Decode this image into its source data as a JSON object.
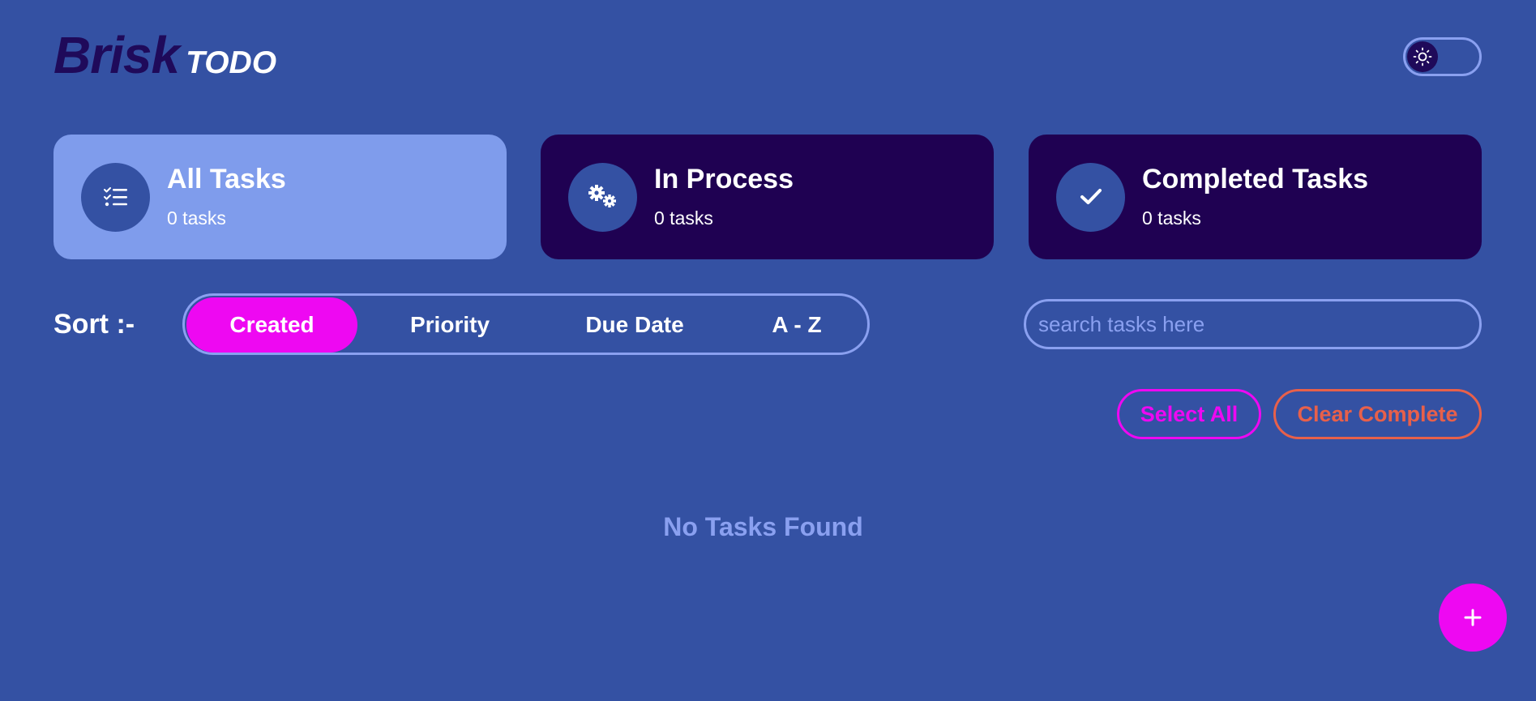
{
  "app": {
    "logo_brand": "Brisk",
    "logo_suffix": "TODO"
  },
  "theme_toggle": {
    "icon": "sun-icon",
    "state": "dark"
  },
  "cards": [
    {
      "title": "All Tasks",
      "count": "0 tasks",
      "icon": "list-check-icon",
      "active": true
    },
    {
      "title": "In Process",
      "count": "0 tasks",
      "icon": "gears-icon",
      "active": false
    },
    {
      "title": "Completed Tasks",
      "count": "0 tasks",
      "icon": "check-icon",
      "active": false
    }
  ],
  "sort": {
    "label": "Sort :-",
    "options": [
      "Created",
      "Priority",
      "Due Date",
      "A - Z"
    ],
    "selected": "Created"
  },
  "search": {
    "placeholder": "search tasks here",
    "value": ""
  },
  "actions": {
    "select_all": "Select All",
    "clear_complete": "Clear Complete"
  },
  "empty_message": "No Tasks Found",
  "fab": {
    "label": "+",
    "icon": "plus-icon"
  },
  "colors": {
    "background": "#3451a3",
    "card_dark": "#1f0152",
    "card_active": "#7f9cec",
    "accent_magenta": "#ee08f2",
    "accent_orange": "#e8604a",
    "muted_blue": "#8aa0f0"
  }
}
